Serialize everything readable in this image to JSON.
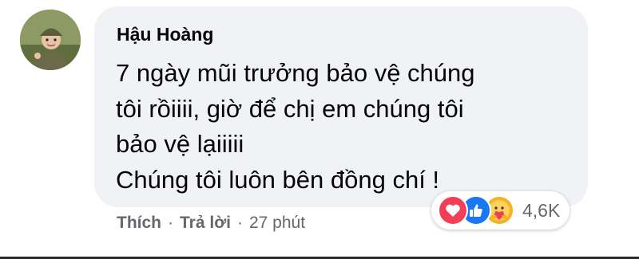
{
  "comment": {
    "author": "Hậu Hoàng",
    "lines": [
      "7 ngày mũi trưởng bảo vệ chúng",
      "tôi rồiiii, giờ để chị em chúng tôi",
      "bảo vệ lạiiiii",
      "Chúng tôi luôn bên đồng chí !"
    ]
  },
  "actions": {
    "like_label": "Thích",
    "separator": "·",
    "reply_label": "Trả lời",
    "timestamp": "27 phút"
  },
  "reactions": {
    "icons": [
      "love-icon",
      "like-icon",
      "care-icon"
    ],
    "count": "4,6K"
  },
  "colors": {
    "bubble": "#f0f2f5",
    "love": "#f33e58",
    "like": "#1877f2",
    "care": "#f7b125",
    "meta_text": "#65676b"
  }
}
